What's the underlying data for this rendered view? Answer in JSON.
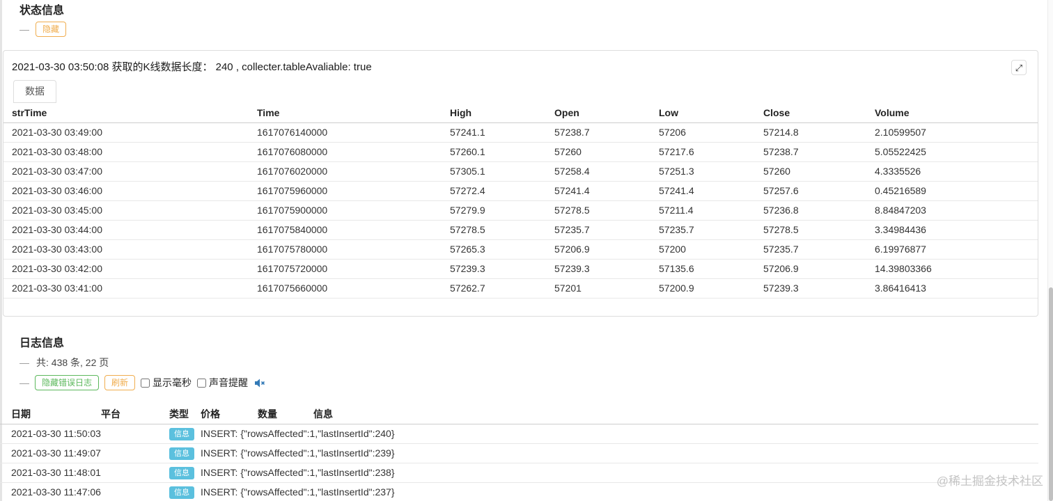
{
  "colors": {
    "warning_accent": "#f0ad4e",
    "success_accent": "#5cb85c",
    "info_badge": "#5bc0de",
    "speaker_blue": "#337ab7",
    "border": "#dddddd",
    "watermark_gray": "#c4c4c4"
  },
  "icons": {
    "expand_icon": "⤢",
    "collapse_dash": "—"
  },
  "status_section": {
    "title": "状态信息",
    "hide_button": "隐藏"
  },
  "kline_panel": {
    "header_text": "2021-03-30 03:50:08 获取的K线数据长度： 240 , collecter.tableAvaliable: true",
    "tab_label": "数据",
    "table": {
      "columns": [
        "strTime",
        "Time",
        "High",
        "Open",
        "Low",
        "Close",
        "Volume"
      ],
      "rows": [
        [
          "2021-03-30 03:49:00",
          "1617076140000",
          "57241.1",
          "57238.7",
          "57206",
          "57214.8",
          "2.10599507"
        ],
        [
          "2021-03-30 03:48:00",
          "1617076080000",
          "57260.1",
          "57260",
          "57217.6",
          "57238.7",
          "5.05522425"
        ],
        [
          "2021-03-30 03:47:00",
          "1617076020000",
          "57305.1",
          "57258.4",
          "57251.3",
          "57260",
          "4.3335526"
        ],
        [
          "2021-03-30 03:46:00",
          "1617075960000",
          "57272.4",
          "57241.4",
          "57241.4",
          "57257.6",
          "0.45216589"
        ],
        [
          "2021-03-30 03:45:00",
          "1617075900000",
          "57279.9",
          "57278.5",
          "57211.4",
          "57236.8",
          "8.84847203"
        ],
        [
          "2021-03-30 03:44:00",
          "1617075840000",
          "57278.5",
          "57235.7",
          "57235.7",
          "57278.5",
          "3.34984436"
        ],
        [
          "2021-03-30 03:43:00",
          "1617075780000",
          "57265.3",
          "57206.9",
          "57200",
          "57235.7",
          "6.19976877"
        ],
        [
          "2021-03-30 03:42:00",
          "1617075720000",
          "57239.3",
          "57239.3",
          "57135.6",
          "57206.9",
          "14.39803366"
        ],
        [
          "2021-03-30 03:41:00",
          "1617075660000",
          "57262.7",
          "57201",
          "57200.9",
          "57239.3",
          "3.86416413"
        ]
      ]
    }
  },
  "log_section": {
    "title": "日志信息",
    "count_text": "共: 438 条, 22 页",
    "hide_error_button": "隐藏错误日志",
    "refresh_button": "刷新",
    "show_ms_label": "显示毫秒",
    "sound_label": "声音提醒",
    "table": {
      "columns": [
        "日期",
        "平台",
        "类型",
        "价格",
        "数量",
        "信息"
      ],
      "rows": [
        {
          "date": "2021-03-30 11:50:03",
          "platform": "",
          "type": "信息",
          "message": "INSERT: {\"rowsAffected\":1,\"lastInsertId\":240}"
        },
        {
          "date": "2021-03-30 11:49:07",
          "platform": "",
          "type": "信息",
          "message": "INSERT: {\"rowsAffected\":1,\"lastInsertId\":239}"
        },
        {
          "date": "2021-03-30 11:48:01",
          "platform": "",
          "type": "信息",
          "message": "INSERT: {\"rowsAffected\":1,\"lastInsertId\":238}"
        },
        {
          "date": "2021-03-30 11:47:06",
          "platform": "",
          "type": "信息",
          "message": "INSERT: {\"rowsAffected\":1,\"lastInsertId\":237}"
        }
      ]
    }
  },
  "page": {
    "watermark": "@稀土掘金技术社区"
  }
}
